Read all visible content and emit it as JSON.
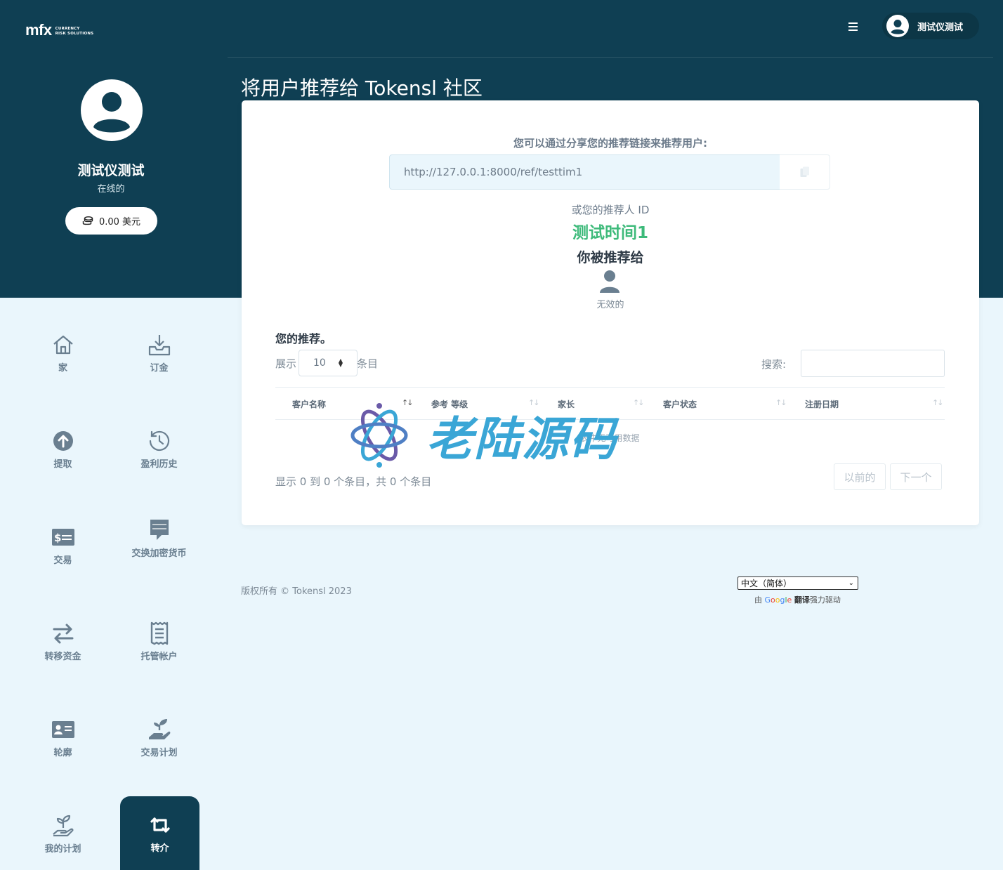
{
  "brand": {
    "logo_main": "mfx",
    "logo_sub_1": "CURRENCY",
    "logo_sub_2": "RISK SOLUTIONS"
  },
  "header": {
    "user_name": "测试仪测试"
  },
  "profile": {
    "name": "测试仪测试",
    "status": "在线的",
    "balance": "0.00 美元"
  },
  "nav": [
    {
      "label": "家",
      "icon": "home-icon"
    },
    {
      "label": "订金",
      "icon": "deposit-icon"
    },
    {
      "label": "提取",
      "icon": "withdraw-icon"
    },
    {
      "label": "盈利历史",
      "icon": "history-icon"
    },
    {
      "label": "交易",
      "icon": "money-icon"
    },
    {
      "label": "交换加密货币",
      "icon": "chat-icon"
    },
    {
      "label": "转移资金",
      "icon": "transfer-icon"
    },
    {
      "label": "托管帐户",
      "icon": "receipt-icon"
    },
    {
      "label": "轮廓",
      "icon": "id-card-icon"
    },
    {
      "label": "交易计划",
      "icon": "plant-hand-icon"
    },
    {
      "label": "我的计划",
      "icon": "seedling-icon"
    },
    {
      "label": "转介",
      "icon": "retweet-icon"
    }
  ],
  "page": {
    "title": "将用户推荐给 Tokensl 社区"
  },
  "referral": {
    "share_label": "您可以通过分享您的推荐链接来推荐用户:",
    "link": "http://127.0.0.1:8000/ref/testtim1",
    "id_label": "或您的推荐人 ID",
    "id_value": "测试时间1",
    "referred_by_label": "你被推荐给",
    "referrer_status": "无效的"
  },
  "table": {
    "title": "您的推荐。",
    "show_label": "展示",
    "page_size": "10",
    "entries_label": "条目",
    "search_label": "搜索:",
    "columns": [
      "客户名称",
      "参考 等级",
      "家长",
      "客户状态",
      "注册日期"
    ],
    "empty_text": "表中无可用数据",
    "info": "显示 0 到 0 个条目，共 0 个条目",
    "prev_label": "以前的",
    "next_label": "下一个"
  },
  "footer": {
    "copyright": "版权所有 © Tokensl 2023",
    "language": "中文（简体）",
    "powered_prefix": "由",
    "powered_suffix": "翻译",
    "powered_tail": "强力驱动"
  },
  "watermark": {
    "text": "老陆源码"
  },
  "colors": {
    "navy": "#0f3f53",
    "background": "#eaf6fc",
    "accent_green": "#3dba7a",
    "muted": "#6a7f90"
  }
}
